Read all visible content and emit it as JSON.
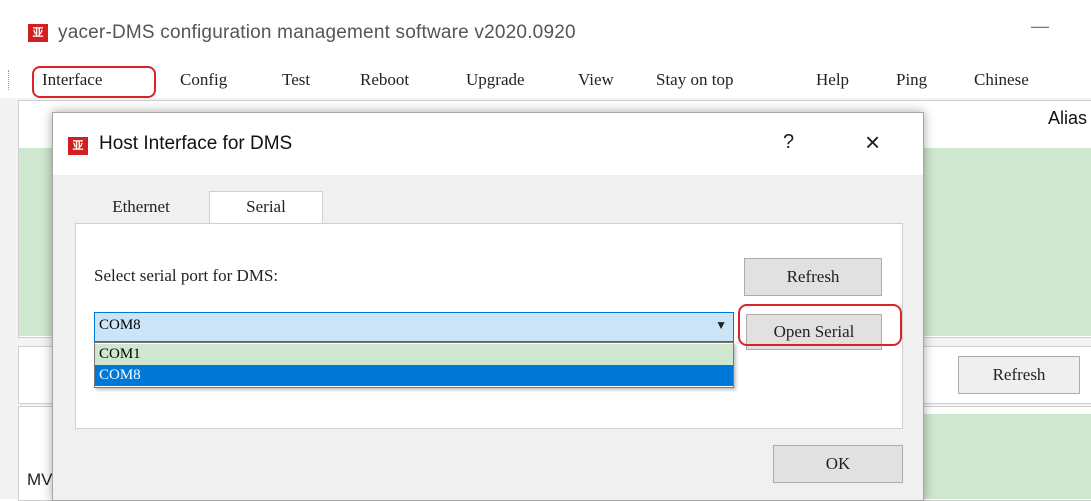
{
  "window": {
    "logo_text": "亚",
    "title": "yacer-DMS configuration management software v2020.0920",
    "minimize_symbol": "—"
  },
  "menu": {
    "items": [
      "Interface",
      "Config",
      "Test",
      "Reboot",
      "Upgrade",
      "View",
      "Stay on top",
      "Help",
      "Ping",
      "Chinese"
    ]
  },
  "background": {
    "alias_label": "Alias",
    "refresh_label": "Refresh",
    "mv_label": "MV"
  },
  "dialog": {
    "logo_text": "亚",
    "title": "Host Interface for DMS",
    "help_symbol": "?",
    "close_symbol": "×",
    "tabs": [
      "Ethernet",
      "Serial"
    ],
    "active_tab": "Serial",
    "serial_label": "Select serial port for DMS:",
    "refresh_label": "Refresh",
    "port_select": {
      "value": "COM8",
      "options": [
        "COM1",
        "COM8"
      ],
      "highlighted": "COM8"
    },
    "open_serial_label": "Open Serial",
    "ok_label": "OK"
  },
  "colors": {
    "highlight_annotation": "#d8232a",
    "selection_blue": "#0078d7",
    "panel_green": "#cfe6cf",
    "logo_red": "#d21f1f"
  }
}
